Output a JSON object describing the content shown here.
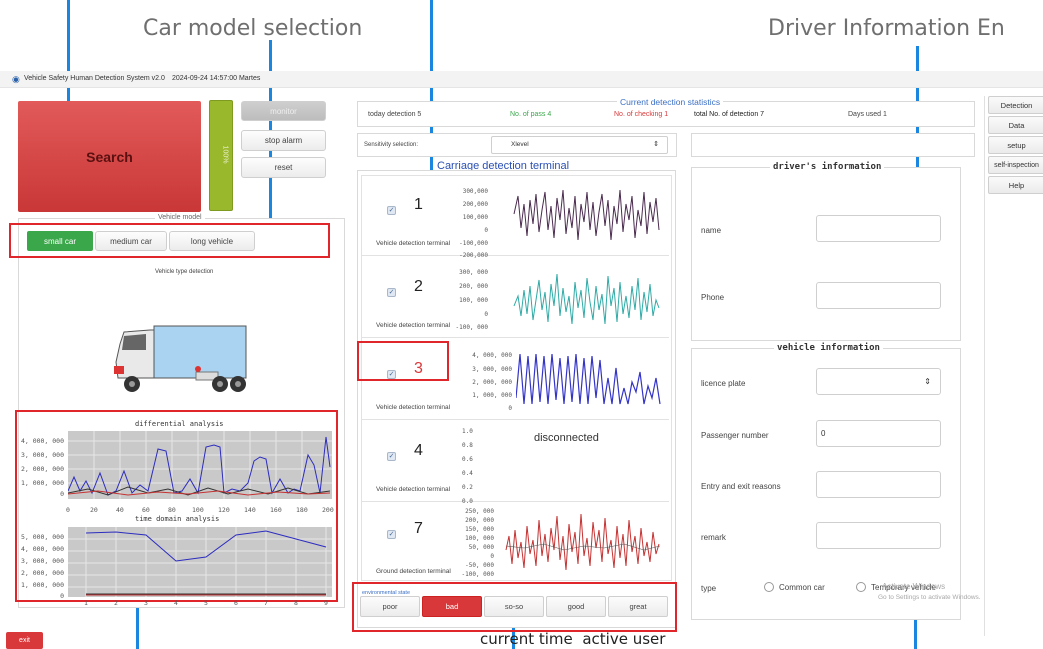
{
  "annotations": {
    "car_model": "Car model selection",
    "driver_info": "Driver Information En",
    "current_time": "current time",
    "active_user": "active user"
  },
  "window": {
    "title": "Vehicle Safety Human Detection System v2.0",
    "datetime": "2024-09-24 14:57:00 Martes"
  },
  "controls": {
    "search": "Search",
    "progress": "100%",
    "progress_value": 100,
    "monitor": "monitor",
    "stop_alarm": "stop alarm",
    "reset": "reset"
  },
  "car_tabs": {
    "title": "Vehicle model",
    "items": [
      "small car",
      "medium car",
      "long vehicle"
    ],
    "selected": "small car"
  },
  "vehicle_detection": {
    "label": "Vehicle type detection"
  },
  "analysis": {
    "diff_title": "differential analysis",
    "time_title": "time domain analysis",
    "diff_y": [
      "4, 000, 000",
      "3, 000, 000",
      "2, 000, 000",
      "1, 000, 000",
      "0"
    ],
    "diff_x": [
      "0",
      "20",
      "40",
      "60",
      "80",
      "100",
      "120",
      "140",
      "160",
      "180",
      "200"
    ],
    "time_y": [
      "5, 000, 000",
      "4, 000, 000",
      "3, 000, 000",
      "2, 000, 000",
      "1, 000, 000",
      "0"
    ],
    "time_x": [
      "1",
      "2",
      "3",
      "4",
      "5",
      "6",
      "7",
      "8",
      "9"
    ]
  },
  "stats": {
    "title": "Current detection statistics",
    "today": "today detection 5",
    "pass": "No. of pass 4",
    "checking": "No. of checking 1",
    "total": "total No. of detection 7",
    "days": "Days used 1"
  },
  "sensitivity": {
    "label": "Sensitivity selection:",
    "value": "Xlevel"
  },
  "carriage": {
    "title": "Carriage detection terminal",
    "terminals": [
      {
        "num": "1",
        "label": "Vehicle detection terminal",
        "y": [
          "300,000",
          "200,000",
          "100,000",
          "0",
          "-100,000",
          "-200,000"
        ]
      },
      {
        "num": "2",
        "label": "Vehicle detection terminal",
        "y": [
          "300, 000",
          "200, 000",
          "100, 000",
          "0",
          "-100, 000"
        ]
      },
      {
        "num": "3",
        "label": "Vehicle detection terminal",
        "y": [
          "4, 000, 000",
          "3, 000, 000",
          "2, 000, 000",
          "1, 000, 000",
          "0"
        ]
      },
      {
        "num": "4",
        "label": "Vehicle detection terminal",
        "y": [
          "1.0",
          "0.8",
          "0.6",
          "0.4",
          "0.2",
          "0.0"
        ],
        "status": "disconnected"
      },
      {
        "num": "7",
        "label": "Ground detection terminal",
        "y": [
          "250, 000",
          "200, 000",
          "150, 000",
          "100, 000",
          "50, 000",
          "0",
          "-50, 000",
          "-100, 000"
        ]
      }
    ]
  },
  "environment": {
    "title": "environmental state",
    "items": [
      "poor",
      "bad",
      "so-so",
      "good",
      "great"
    ],
    "selected": "bad"
  },
  "driver": {
    "title": "driver's information",
    "name_label": "name",
    "name_value": "",
    "phone_label": "Phone",
    "phone_value": ""
  },
  "vehicle": {
    "title": "vehicle information",
    "plate_label": "licence plate",
    "plate_value": "",
    "passenger_label": "Passenger number",
    "passenger_value": "0",
    "reasons_label": "Entry and exit reasons",
    "reasons_value": "",
    "remark_label": "remark",
    "remark_value": "",
    "type_label": "type",
    "type_options": [
      "Common car",
      "Temporary vehicle"
    ]
  },
  "side_menu": [
    "Detection",
    "Data",
    "setup",
    "self-inspection",
    "Help"
  ],
  "watermark": {
    "line1": "Activate Windows",
    "line2": "Go to Settings to activate Windows."
  },
  "exit_button": "exit",
  "colors": {
    "accent": "#1a86e0",
    "red": "#d9383a",
    "green": "#3aa84a"
  }
}
